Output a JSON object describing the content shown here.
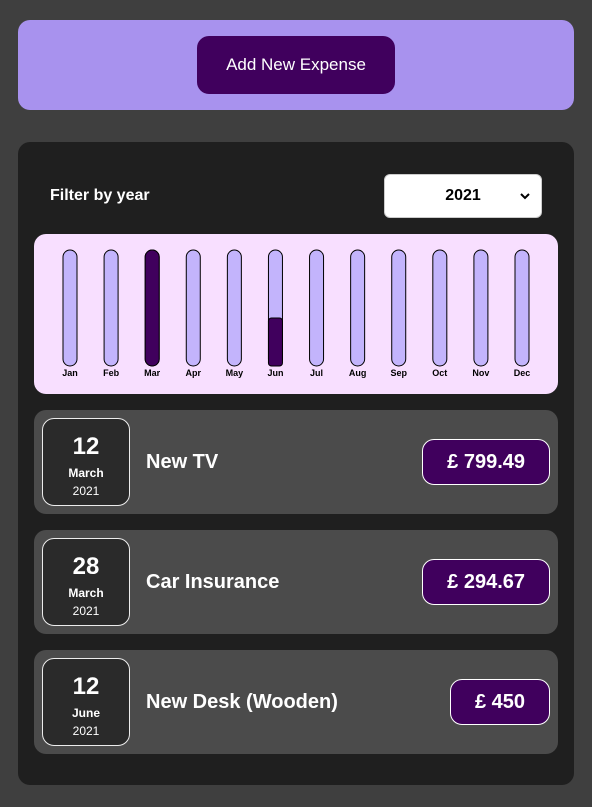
{
  "new_expense": {
    "add_button_label": "Add New Expense"
  },
  "filter": {
    "label": "Filter by year",
    "selected_year": "2021"
  },
  "chart_data": {
    "type": "bar",
    "categories": [
      "Jan",
      "Feb",
      "Mar",
      "Apr",
      "May",
      "Jun",
      "Jul",
      "Aug",
      "Sep",
      "Oct",
      "Nov",
      "Dec"
    ],
    "values": [
      0,
      0,
      1094.16,
      0,
      0,
      450,
      0,
      0,
      0,
      0,
      0,
      0
    ],
    "max_value": 1094.16,
    "colors": {
      "empty": "#c3b4fc",
      "fill": "#4826b9",
      "fill_dark": "#40005d",
      "border": "#000000"
    }
  },
  "expenses": [
    {
      "day": "12",
      "month": "March",
      "year": "2021",
      "title": "New TV",
      "amount": "£ 799.49"
    },
    {
      "day": "28",
      "month": "March",
      "year": "2021",
      "title": "Car Insurance",
      "amount": "£ 294.67"
    },
    {
      "day": "12",
      "month": "June",
      "year": "2021",
      "title": "New Desk (Wooden)",
      "amount": "£ 450"
    }
  ]
}
